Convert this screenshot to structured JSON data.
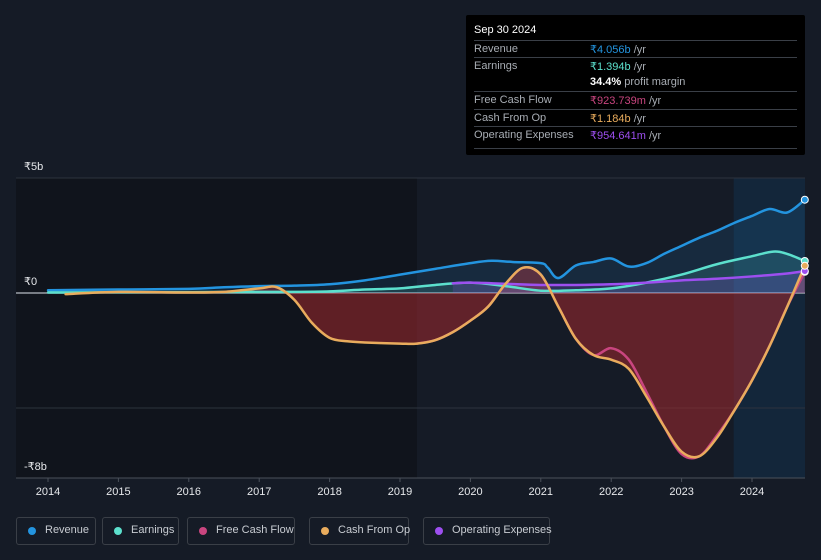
{
  "tooltip": {
    "date": "Sep 30 2024",
    "rows": [
      {
        "label": "Revenue",
        "value": "₹4.056b",
        "unit": " /yr",
        "color": "#2394df"
      },
      {
        "label": "Earnings",
        "value": "₹1.394b",
        "unit": " /yr",
        "color": "#5ce0cd"
      },
      {
        "label": "",
        "value": "34.4%",
        "unit": " profit margin",
        "color": "#ffffff"
      },
      {
        "label": "Free Cash Flow",
        "value": "₹923.739m",
        "unit": " /yr",
        "color": "#c9457f"
      },
      {
        "label": "Cash From Op",
        "value": "₹1.184b",
        "unit": " /yr",
        "color": "#e9ac5d"
      },
      {
        "label": "Operating Expenses",
        "value": "₹954.641m",
        "unit": " /yr",
        "color": "#9d4ff0"
      }
    ]
  },
  "legend": [
    {
      "label": "Revenue",
      "color": "#2394df"
    },
    {
      "label": "Earnings",
      "color": "#5ce0cd"
    },
    {
      "label": "Free Cash Flow",
      "color": "#c9457f"
    },
    {
      "label": "Cash From Op",
      "color": "#e9ac5d"
    },
    {
      "label": "Operating Expenses",
      "color": "#9d4ff0"
    }
  ],
  "chart_data": {
    "type": "line",
    "title": "",
    "xlabel": "",
    "ylabel": "",
    "y_unit": "₹ billions",
    "ylim": [
      -8,
      5
    ],
    "xlim": [
      2013.55,
      2024.75
    ],
    "y_tick_labels": [
      {
        "value": 5,
        "label": "₹5b"
      },
      {
        "value": 0,
        "label": "₹0"
      },
      {
        "value": -8,
        "label": "-₹8b"
      }
    ],
    "gridlines_at": [
      5,
      0,
      -5
    ],
    "x_tick_labels": [
      "2014",
      "2015",
      "2016",
      "2017",
      "2018",
      "2019",
      "2020",
      "2021",
      "2022",
      "2023",
      "2024"
    ],
    "x_ticks": [
      2014,
      2015,
      2016,
      2017,
      2018,
      2019,
      2020,
      2021,
      2022,
      2023,
      2024
    ],
    "highlight_start": 2023.74,
    "past_shade_end": 2019.24,
    "legend_position": "bottom",
    "series": [
      {
        "name": "Revenue",
        "color": "#2394df",
        "x": [
          2014,
          2015,
          2016,
          2016.5,
          2017,
          2017.5,
          2018,
          2018.5,
          2019,
          2019.5,
          2020,
          2020.3,
          2020.6,
          2021,
          2021.1,
          2021.25,
          2021.5,
          2021.75,
          2022,
          2022.25,
          2022.5,
          2022.75,
          2023,
          2023.25,
          2023.5,
          2023.75,
          2024,
          2024.25,
          2024.5,
          2024.75
        ],
        "y": [
          0.12,
          0.15,
          0.18,
          0.25,
          0.3,
          0.32,
          0.38,
          0.55,
          0.8,
          1.05,
          1.3,
          1.4,
          1.35,
          1.3,
          1.1,
          0.65,
          1.2,
          1.35,
          1.5,
          1.15,
          1.3,
          1.7,
          2.05,
          2.4,
          2.7,
          3.05,
          3.35,
          3.65,
          3.5,
          4.056
        ]
      },
      {
        "name": "Earnings",
        "color": "#5ce0cd",
        "x": [
          2014,
          2015,
          2016,
          2017,
          2017.5,
          2018,
          2018.5,
          2019,
          2019.5,
          2020,
          2020.5,
          2021,
          2021.5,
          2022,
          2022.5,
          2023,
          2023.5,
          2024,
          2024.3,
          2024.5,
          2024.75
        ],
        "y": [
          0.02,
          0.03,
          0.04,
          0.05,
          0.05,
          0.07,
          0.15,
          0.2,
          0.35,
          0.45,
          0.3,
          0.1,
          0.12,
          0.2,
          0.45,
          0.8,
          1.25,
          1.6,
          1.8,
          1.7,
          1.394
        ]
      },
      {
        "name": "Free Cash Flow",
        "color": "#c9457f",
        "x": [
          2019.24,
          2019.5,
          2019.75,
          2020,
          2020.25,
          2020.5,
          2020.75,
          2021,
          2021.25,
          2021.5,
          2021.75,
          2022,
          2022.25,
          2022.5,
          2022.75,
          2023,
          2023.25,
          2023.5,
          2023.75,
          2024,
          2024.25,
          2024.5,
          2024.75
        ],
        "y": [
          -2.2,
          -2.05,
          -1.7,
          -1.2,
          -0.6,
          0.4,
          1.1,
          0.8,
          -0.6,
          -2.0,
          -2.7,
          -2.4,
          -2.9,
          -4.3,
          -5.8,
          -7.0,
          -7.1,
          -6.2,
          -5.1,
          -3.8,
          -2.3,
          -0.6,
          0.924
        ]
      },
      {
        "name": "Cash From Op",
        "color": "#e9ac5d",
        "x": [
          2014.25,
          2015,
          2016,
          2016.5,
          2017,
          2017.25,
          2017.5,
          2017.75,
          2018,
          2018.25,
          2018.5,
          2019,
          2019.24,
          2019.5,
          2019.75,
          2020,
          2020.25,
          2020.5,
          2020.75,
          2021,
          2021.25,
          2021.5,
          2021.75,
          2022,
          2022.25,
          2022.5,
          2022.75,
          2023,
          2023.25,
          2023.5,
          2023.75,
          2024,
          2024.25,
          2024.5,
          2024.75
        ],
        "y": [
          -0.05,
          0.05,
          0.02,
          0.05,
          0.2,
          0.25,
          -0.3,
          -1.3,
          -1.95,
          -2.1,
          -2.15,
          -2.2,
          -2.2,
          -2.05,
          -1.7,
          -1.2,
          -0.6,
          0.4,
          1.1,
          0.8,
          -0.6,
          -2.0,
          -2.7,
          -2.9,
          -3.3,
          -4.5,
          -5.8,
          -6.9,
          -7.1,
          -6.3,
          -5.1,
          -3.8,
          -2.3,
          -0.6,
          1.184
        ]
      },
      {
        "name": "Operating Expenses",
        "color": "#9d4ff0",
        "x": [
          2019.75,
          2020,
          2020.5,
          2021,
          2021.5,
          2022,
          2022.5,
          2023,
          2023.5,
          2024,
          2024.5,
          2024.75
        ],
        "y": [
          0.42,
          0.45,
          0.4,
          0.35,
          0.35,
          0.38,
          0.45,
          0.55,
          0.62,
          0.72,
          0.85,
          0.955
        ]
      }
    ]
  }
}
